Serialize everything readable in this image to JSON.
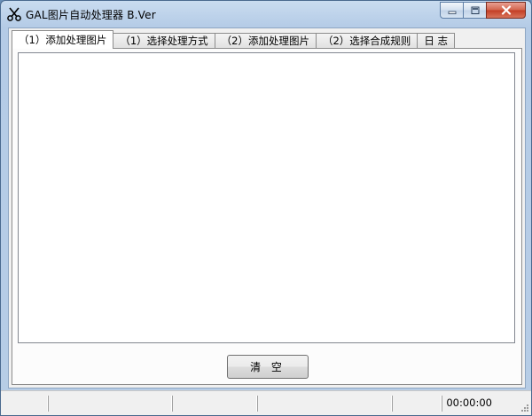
{
  "window": {
    "title": "GAL图片自动处理器 B.Ver"
  },
  "tabs": [
    {
      "label": "（1）添加处理图片",
      "active": true
    },
    {
      "label": "（1）选择处理方式",
      "active": false
    },
    {
      "label": "（2）添加处理图片",
      "active": false
    },
    {
      "label": "（2）选择合成规则",
      "active": false
    },
    {
      "label": "日 志",
      "active": false
    }
  ],
  "main": {
    "clear_label": "清 空"
  },
  "statusbar": {
    "timer": "00:00:00"
  },
  "icons": {
    "app": "scissors-icon",
    "minimize": "minimize-icon",
    "maximize": "maximize-icon",
    "close": "close-icon"
  },
  "colors": {
    "titlebar": "#b9cfe8",
    "close_button": "#c8452c"
  }
}
